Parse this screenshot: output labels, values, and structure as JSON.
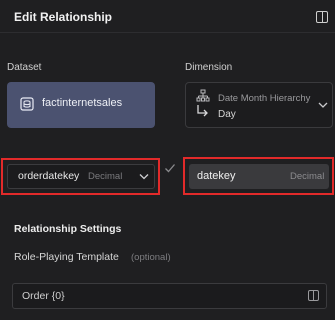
{
  "header": {
    "title": "Edit Relationship"
  },
  "dataset": {
    "label": "Dataset",
    "name": "factinternetsales"
  },
  "dimension": {
    "label": "Dimension",
    "name": "Date Month Hierarchy",
    "level": "Day"
  },
  "fields": {
    "left": {
      "value": "orderdatekey",
      "type": "Decimal"
    },
    "right": {
      "value": "datekey",
      "type": "Decimal"
    }
  },
  "settings": {
    "title": "Relationship Settings",
    "role_label": "Role-Playing Template",
    "optional": "(optional)",
    "template_value": "Order {0}"
  },
  "colors": {
    "background": "#1f1f21",
    "dataset_card": "#4b5270",
    "highlight": "#e22a2a"
  },
  "icons": [
    "panel-toggle-icon",
    "dataset-icon",
    "hierarchy-icon",
    "level-arrow-icon",
    "chevron-down-icon",
    "check-icon"
  ]
}
